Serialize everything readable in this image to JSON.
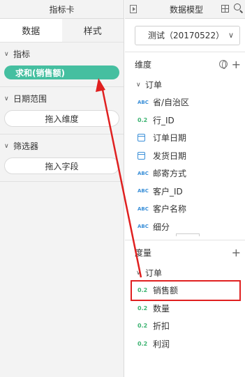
{
  "left": {
    "header": "指标卡",
    "tabs": [
      "数据",
      "样式"
    ],
    "sections": {
      "metrics": {
        "title": "指标",
        "pill": "求和(销售额)"
      },
      "date": {
        "title": "日期范围",
        "drop": "拖入维度"
      },
      "filter": {
        "title": "筛选器",
        "drop": "拖入字段"
      }
    }
  },
  "right": {
    "header": "数据模型",
    "dataset": "测试（20170522）",
    "dimension_label": "维度",
    "dimension_group": "订单",
    "dimensions": [
      {
        "type": "ABC",
        "name": "省/自治区"
      },
      {
        "type": "0.2",
        "name": "行_ID"
      },
      {
        "type": "date",
        "name": "订单日期"
      },
      {
        "type": "date",
        "name": "发货日期"
      },
      {
        "type": "ABC",
        "name": "邮寄方式"
      },
      {
        "type": "ABC",
        "name": "客户_ID"
      },
      {
        "type": "ABC",
        "name": "客户名称"
      },
      {
        "type": "ABC",
        "name": "细分"
      }
    ],
    "measure_label": "度量",
    "measure_group": "订单",
    "measures": [
      {
        "type": "0.2",
        "name": "销售额"
      },
      {
        "type": "0.2",
        "name": "数量"
      },
      {
        "type": "0.2",
        "name": "折扣"
      },
      {
        "type": "0.2",
        "name": "利润"
      }
    ]
  },
  "colors": {
    "pill": "#45bfa0",
    "highlight": "#e02020",
    "abc": "#3a8fd8",
    "num": "#3cb371"
  }
}
